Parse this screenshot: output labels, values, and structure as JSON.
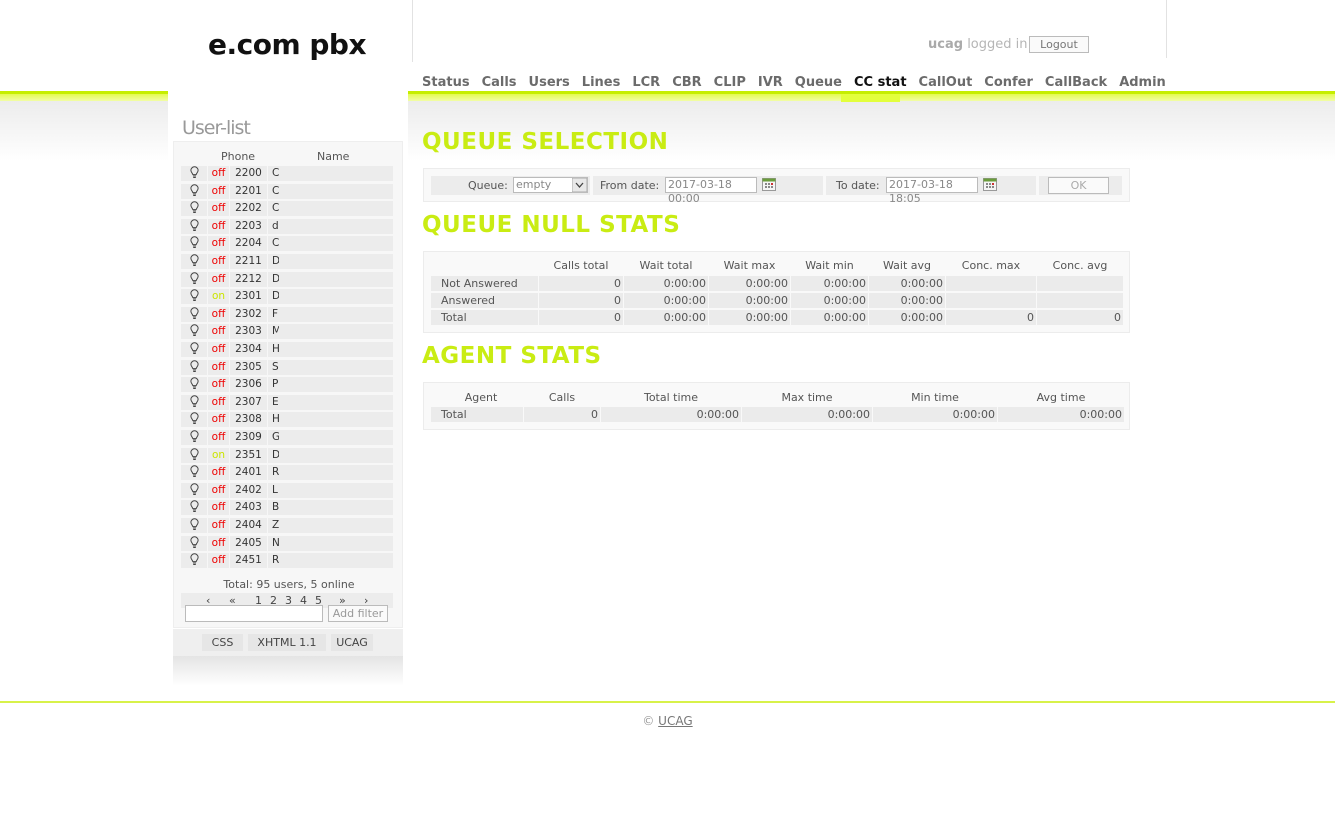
{
  "header": {
    "logo": "e.com pbx",
    "user": "ucag",
    "logged_in_text": "logged in",
    "logout_label": "Logout"
  },
  "nav": {
    "items": [
      "Status",
      "Calls",
      "Users",
      "Lines",
      "LCR",
      "CBR",
      "CLIP",
      "IVR",
      "Queue",
      "CC stat",
      "CallOut",
      "Confer",
      "CallBack",
      "Admin"
    ],
    "active": "CC stat"
  },
  "sidebar": {
    "title": "User-list",
    "col_phone": "Phone",
    "col_name": "Name",
    "users": [
      {
        "status": "off",
        "phone": "2200",
        "name": "C"
      },
      {
        "status": "off",
        "phone": "2201",
        "name": "C"
      },
      {
        "status": "off",
        "phone": "2202",
        "name": "C"
      },
      {
        "status": "off",
        "phone": "2203",
        "name": "d"
      },
      {
        "status": "off",
        "phone": "2204",
        "name": "C"
      },
      {
        "status": "off",
        "phone": "2211",
        "name": "D"
      },
      {
        "status": "off",
        "phone": "2212",
        "name": "D"
      },
      {
        "status": "on",
        "phone": "2301",
        "name": "D"
      },
      {
        "status": "off",
        "phone": "2302",
        "name": "F"
      },
      {
        "status": "off",
        "phone": "2303",
        "name": "M"
      },
      {
        "status": "off",
        "phone": "2304",
        "name": "H"
      },
      {
        "status": "off",
        "phone": "2305",
        "name": "Si"
      },
      {
        "status": "off",
        "phone": "2306",
        "name": "Pi"
      },
      {
        "status": "off",
        "phone": "2307",
        "name": "E"
      },
      {
        "status": "off",
        "phone": "2308",
        "name": "H"
      },
      {
        "status": "off",
        "phone": "2309",
        "name": "G"
      },
      {
        "status": "on",
        "phone": "2351",
        "name": "D"
      },
      {
        "status": "off",
        "phone": "2401",
        "name": "R"
      },
      {
        "status": "off",
        "phone": "2402",
        "name": "L"
      },
      {
        "status": "off",
        "phone": "2403",
        "name": "Bl"
      },
      {
        "status": "off",
        "phone": "2404",
        "name": "Z"
      },
      {
        "status": "off",
        "phone": "2405",
        "name": "N"
      },
      {
        "status": "off",
        "phone": "2451",
        "name": "R"
      }
    ],
    "total_text": "Total: 95 users, 5 online",
    "pager": {
      "first": "‹",
      "prev": "«",
      "pages": [
        "1",
        "2",
        "3",
        "4",
        "5"
      ],
      "next": "»",
      "last": "›"
    },
    "filter_placeholder": "",
    "filter_button": "Add filter",
    "footer_badges": [
      "CSS",
      "XHTML 1.1",
      "UCAG"
    ]
  },
  "queue_selection": {
    "title": "QUEUE SELECTION",
    "queue_label": "Queue:",
    "queue_value": "empty",
    "from_label": "From date:",
    "from_value": "2017-03-18 00:00",
    "to_label": "To date:",
    "to_value": "2017-03-18 18:05",
    "ok_label": "OK"
  },
  "queue_null_stats": {
    "title": "QUEUE NULL STATS",
    "columns": [
      "Calls total",
      "Wait total",
      "Wait max",
      "Wait min",
      "Wait avg",
      "Conc. max",
      "Conc. avg"
    ],
    "rows": [
      {
        "label": "Not Answered",
        "values": [
          "0",
          "0:00:00",
          "0:00:00",
          "0:00:00",
          "0:00:00",
          "",
          ""
        ]
      },
      {
        "label": "Answered",
        "values": [
          "0",
          "0:00:00",
          "0:00:00",
          "0:00:00",
          "0:00:00",
          "",
          ""
        ]
      },
      {
        "label": "Total",
        "values": [
          "0",
          "0:00:00",
          "0:00:00",
          "0:00:00",
          "0:00:00",
          "0",
          "0"
        ]
      }
    ]
  },
  "agent_stats": {
    "title": "AGENT STATS",
    "columns": [
      "Agent",
      "Calls",
      "Total time",
      "Max time",
      "Min time",
      "Avg time"
    ],
    "rows": [
      {
        "label": "Total",
        "values": [
          "0",
          "0:00:00",
          "0:00:00",
          "0:00:00",
          "0:00:00"
        ]
      }
    ]
  },
  "footer": {
    "copyright": "©",
    "link": "UCAG"
  }
}
